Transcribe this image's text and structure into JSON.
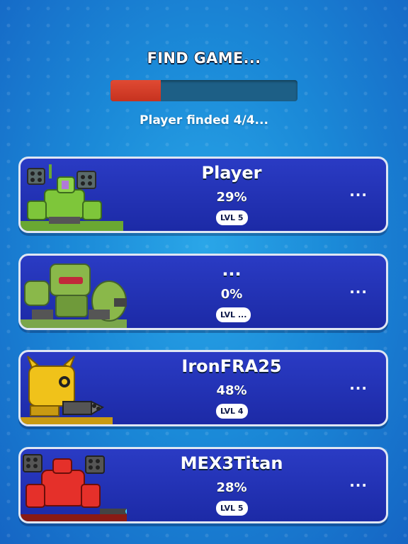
{
  "header": {
    "title": "FIND GAME...",
    "status": "Player finded 4/4...",
    "progress": 0.27
  },
  "players": [
    {
      "name": "Player",
      "percent": "29%",
      "level": "LVL 5",
      "more": "...",
      "mech_icon": "green-missile-mech-icon",
      "mech_color": "#7ec63a"
    },
    {
      "name": "...",
      "percent": "0%",
      "level": "LVL ...",
      "more": "...",
      "mech_icon": "green-cannon-mech-icon",
      "mech_color": "#8ab84a"
    },
    {
      "name": "IronFRA25",
      "percent": "48%",
      "level": "LVL 4",
      "more": "...",
      "mech_icon": "yellow-gatling-mech-icon",
      "mech_color": "#f0c21a"
    },
    {
      "name": "MEX3Titan",
      "percent": "28%",
      "level": "LVL 5",
      "more": "...",
      "mech_icon": "red-missile-mech-icon",
      "mech_color": "#e5302a"
    }
  ]
}
